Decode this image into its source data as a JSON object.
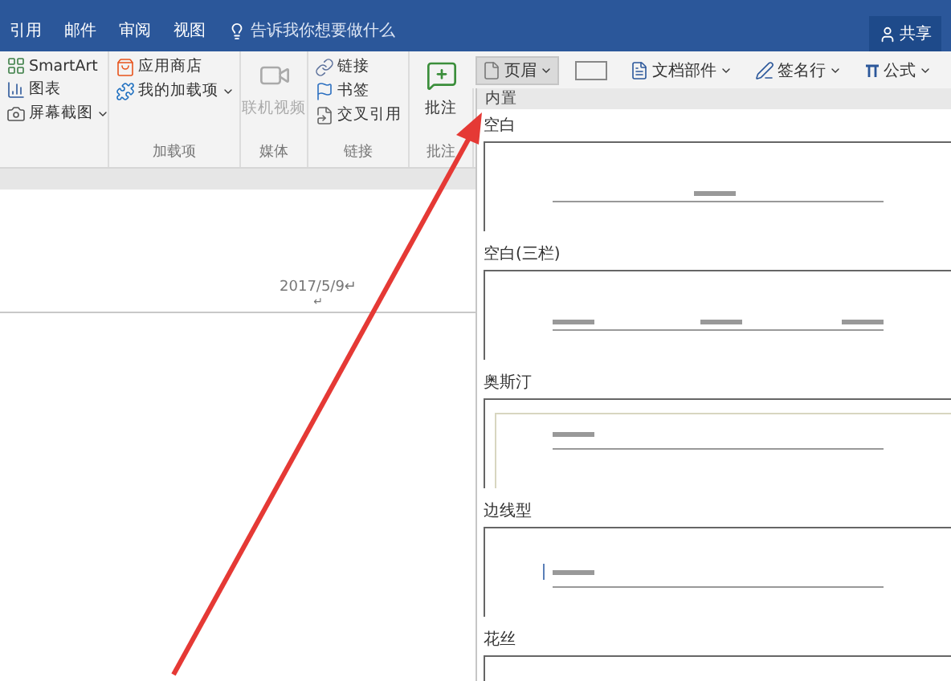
{
  "menu_tabs": [
    {
      "label": "引用"
    },
    {
      "label": "邮件"
    },
    {
      "label": "审阅"
    },
    {
      "label": "视图"
    }
  ],
  "tell_me": {
    "placeholder": "告诉我你想要做什么"
  },
  "share_button": {
    "label": "共享"
  },
  "ribbon_groups": [
    {
      "items": [
        {
          "label": "SmartArt",
          "kind": "smartart",
          "dropdown": false,
          "disabled": false
        },
        {
          "label": "图表",
          "kind": "chart",
          "dropdown": false,
          "disabled": false
        },
        {
          "label": "屏幕截图",
          "kind": "screenshot",
          "dropdown": true,
          "disabled": false
        }
      ]
    },
    {
      "label": "加载项",
      "items": [
        {
          "label": "应用商店",
          "kind": "store",
          "dropdown": false,
          "disabled": false
        },
        {
          "label": "我的加载项",
          "kind": "addins",
          "dropdown": true,
          "disabled": false
        }
      ]
    },
    {
      "label": "媒体",
      "items": [
        {
          "label": "联机视频",
          "kind": "video",
          "dropdown": false,
          "disabled": true,
          "large": true
        }
      ]
    },
    {
      "label": "链接",
      "items": [
        {
          "label": "链接",
          "kind": "link",
          "dropdown": false,
          "disabled": false
        },
        {
          "label": "书签",
          "kind": "bookmark",
          "dropdown": false,
          "disabled": false
        },
        {
          "label": "交叉引用",
          "kind": "crossref",
          "dropdown": false,
          "disabled": false
        }
      ]
    },
    {
      "label": "批注",
      "items": [
        {
          "label": "批注",
          "kind": "comment",
          "dropdown": false,
          "disabled": false,
          "large": true
        }
      ]
    }
  ],
  "header_toolbar": [
    {
      "label": "页眉",
      "kind": "header",
      "dropdown": true,
      "selected": true
    },
    {
      "kind": "textbox",
      "dropdown": false,
      "selected": false
    },
    {
      "label": "文档部件",
      "kind": "parts",
      "dropdown": true,
      "selected": false
    },
    {
      "label": "签名行",
      "kind": "signature",
      "dropdown": true,
      "selected": false
    },
    {
      "label": "公式",
      "kind": "equation",
      "dropdown": true,
      "selected": false
    }
  ],
  "document": {
    "date": "2017/5/9↵",
    "mark": "↵"
  },
  "header_gallery": {
    "section": "内置",
    "options": [
      {
        "label": "空白",
        "kind": "blank"
      },
      {
        "label": "空白(三栏)",
        "kind": "three"
      },
      {
        "label": "奥斯汀",
        "kind": "austin"
      },
      {
        "label": "边线型",
        "kind": "sideline"
      },
      {
        "label": "花丝",
        "kind": "filigree"
      }
    ]
  }
}
